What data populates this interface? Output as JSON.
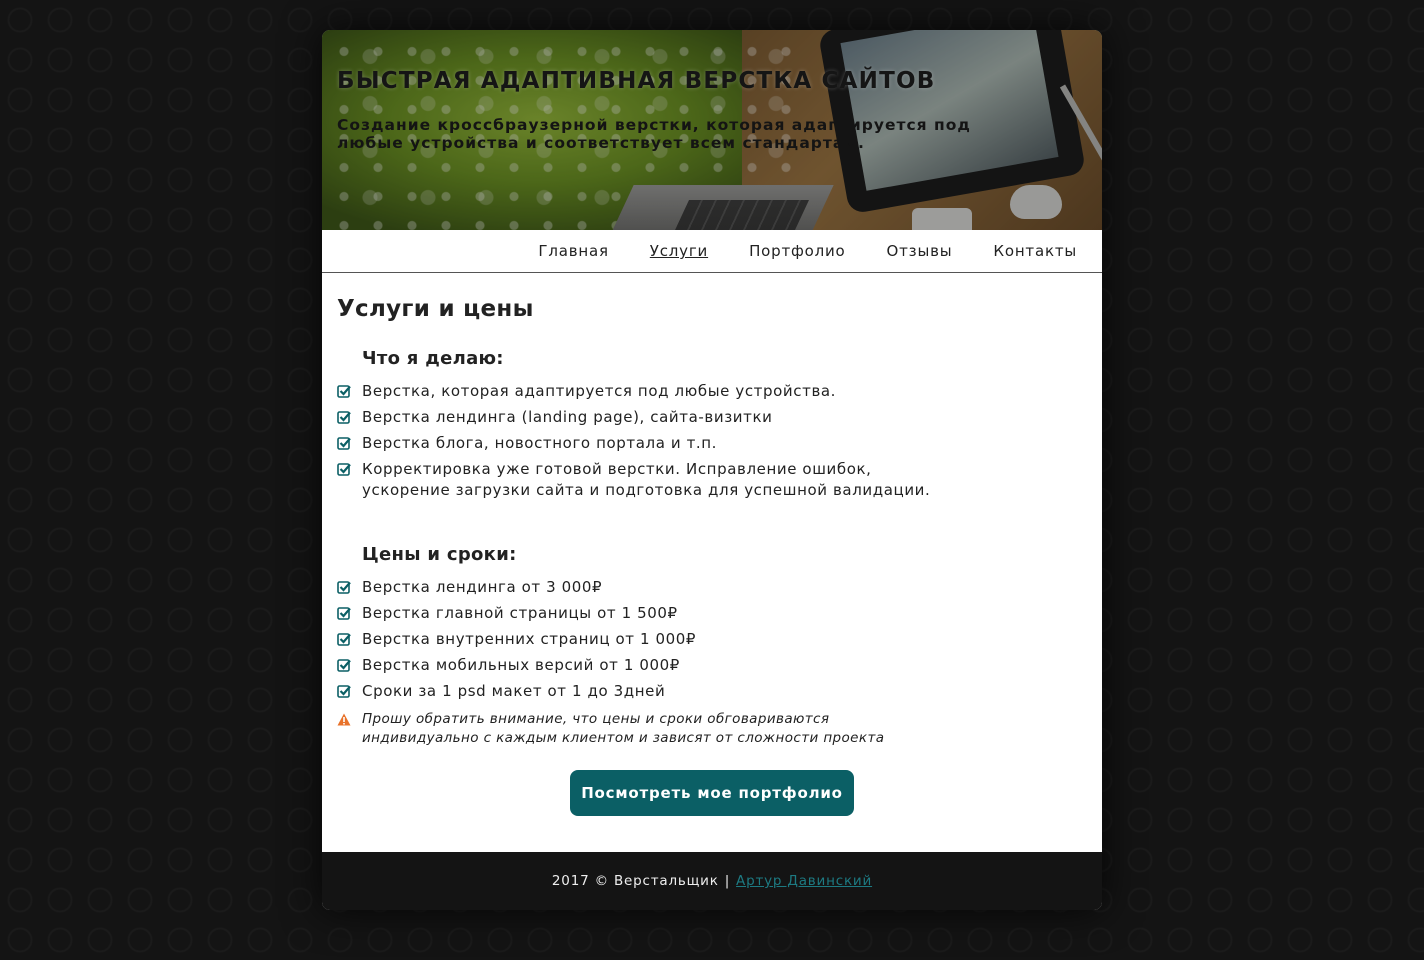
{
  "header": {
    "title": "БЫСТРАЯ АДАПТИВНАЯ ВЕРСТКА САЙТОВ",
    "subtitle": "Создание кроссбраузерной верстки, которая адаптируется под любые устройства и соответствует всем стандартам."
  },
  "nav": {
    "items": [
      {
        "label": "Главная"
      },
      {
        "label": "Услуги"
      },
      {
        "label": "Портфолио"
      },
      {
        "label": "Отзывы"
      },
      {
        "label": "Контакты"
      }
    ],
    "active": "Услуги"
  },
  "main": {
    "title": "Услуги и цены",
    "services": {
      "heading": "Что я делаю:",
      "items": [
        "Верстка, которая адаптируется под любые устройства.",
        "Верстка лендинга (landing page), сайта-визитки",
        "Верстка блога, новостного портала и т.п.",
        "Корректировка уже готовой верстки. Исправление ошибок, ускорение загрузки сайта и подготовка для успешной валидации."
      ]
    },
    "prices": {
      "heading": "Цены и сроки:",
      "items": [
        "Верстка лендинга от 3 000₽",
        "Верстка главной страницы от 1 500₽",
        "Верстка внутренних страниц от 1 000₽",
        "Верстка мобильных версий от 1 000₽",
        "Сроки за 1 psd макет от 1 до 3дней"
      ],
      "note": "Прошу обратить внимание, что цены и сроки обговариваются индивидуально с каждым клиентом и зависят от сложности проекта"
    },
    "cta_label": "Посмотреть мое портфолио"
  },
  "footer": {
    "text": "2017 © Верстальщик",
    "separator": "|",
    "author_link": "Артур Давинский"
  },
  "colors": {
    "accent": "#0b5f65",
    "check": "#0b5f65",
    "warning": "#e8722a",
    "link": "#1d7a82",
    "footer_bg": "#141414"
  }
}
